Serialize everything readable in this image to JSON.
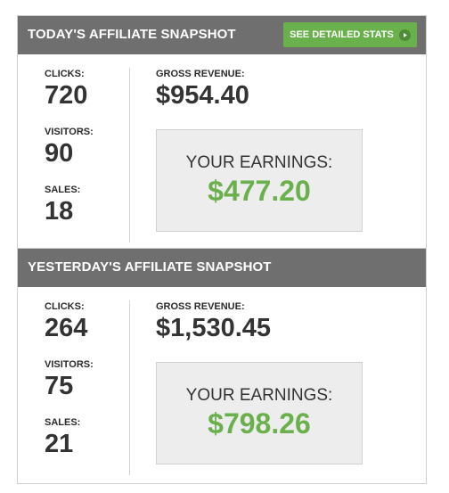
{
  "today": {
    "title": "TODAY'S AFFILIATE SNAPSHOT",
    "button_label": "SEE DETAILED STATS",
    "clicks_label": "CLICKS:",
    "clicks_value": "720",
    "visitors_label": "VISITORS:",
    "visitors_value": "90",
    "sales_label": "SALES:",
    "sales_value": "18",
    "gross_label": "GROSS REVENUE:",
    "gross_value": "$954.40",
    "earnings_label": "YOUR EARNINGS:",
    "earnings_value": "$477.20"
  },
  "yesterday": {
    "title": "YESTERDAY'S AFFILIATE SNAPSHOT",
    "clicks_label": "CLICKS:",
    "clicks_value": "264",
    "visitors_label": "VISITORS:",
    "visitors_value": "75",
    "sales_label": "SALES:",
    "sales_value": "21",
    "gross_label": "GROSS REVENUE:",
    "gross_value": "$1,530.45",
    "earnings_label": "YOUR EARNINGS:",
    "earnings_value": "$798.26"
  },
  "colors": {
    "header_bg": "#6f6f6f",
    "accent_green": "#6ab04c",
    "earnings_box_bg": "#ededed"
  },
  "icons": {
    "button_icon": "play-circle-icon"
  }
}
